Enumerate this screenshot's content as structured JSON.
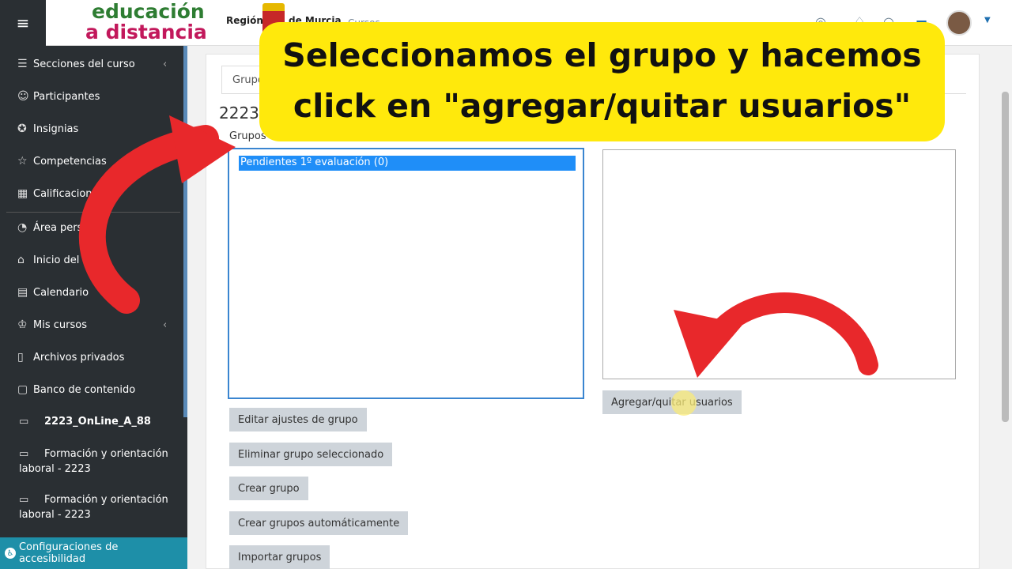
{
  "header": {
    "logo_line1": "educación",
    "logo_line2": "a distancia",
    "region_left": "Región",
    "region_right": "de Murcia",
    "cursos_link": "Cursos"
  },
  "sidebar": {
    "items": [
      {
        "label": "Secciones del curso",
        "icon": "list-icon"
      },
      {
        "label": "Participantes",
        "icon": "users-icon"
      },
      {
        "label": "Insignias",
        "icon": "badge-icon"
      },
      {
        "label": "Competencias",
        "icon": "star-icon"
      },
      {
        "label": "Calificaciones",
        "icon": "grades-icon"
      },
      {
        "label": "Área personal",
        "icon": "dashboard-icon"
      },
      {
        "label": "Inicio del sitio",
        "icon": "home-icon"
      },
      {
        "label": "Calendario",
        "icon": "calendar-icon"
      },
      {
        "label": "Mis cursos",
        "icon": "graduation-icon"
      },
      {
        "label": "Archivos privados",
        "icon": "file-icon"
      },
      {
        "label": "Banco de contenido",
        "icon": "clipboard-icon"
      }
    ],
    "folders": [
      {
        "label": "2223_OnLine_A_88"
      },
      {
        "label": "Formación y orientación laboral - 2223"
      },
      {
        "label": "Formación y orientación laboral - 2223"
      }
    ],
    "accessibility": "Configuraciones de accesibilidad"
  },
  "main": {
    "tab_label": "Grupos",
    "course_title": "2223",
    "groups_label": "Grupos",
    "groups": [
      "Pendientes 1º evaluación (0)"
    ],
    "buttons": {
      "edit": "Editar ajustes de grupo",
      "delete": "Eliminar grupo seleccionado",
      "create": "Crear grupo",
      "auto_create": "Crear grupos automáticamente",
      "import": "Importar grupos",
      "add_remove": "Agregar/quitar usuarios"
    }
  },
  "overlay": {
    "banner_line1": "Seleccionamos el grupo y hacemos",
    "banner_line2": "click en \"agregar/quitar usuarios\"",
    "arrow_color": "#e8282b",
    "banner_color": "#ffe90c"
  }
}
